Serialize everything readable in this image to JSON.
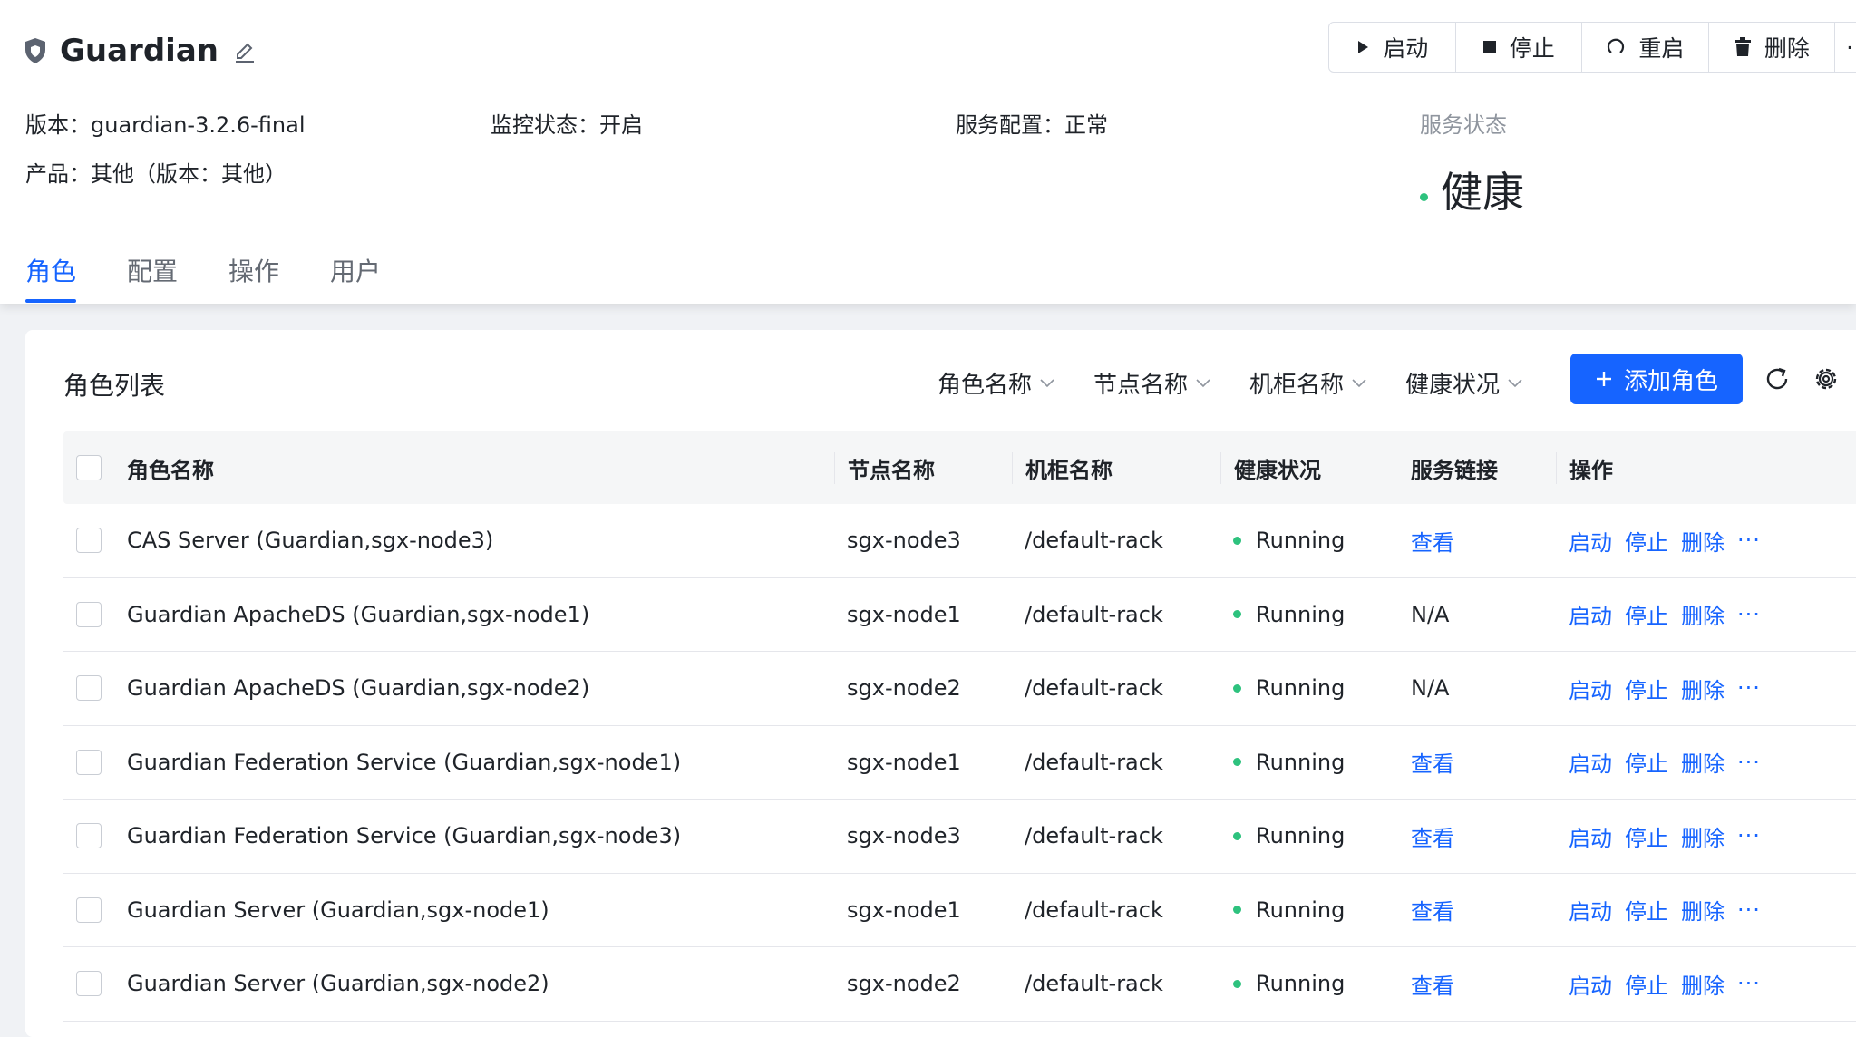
{
  "service": {
    "title": "Guardian",
    "version": "版本：guardian-3.2.6-final",
    "product": "产品：其他（版本：其他）",
    "monitor": "监控状态：开启",
    "config": "服务配置：正常",
    "status_label": "服务状态",
    "status_value": "健康"
  },
  "toolbar": {
    "start": "启动",
    "stop": "停止",
    "restart": "重启",
    "delete": "删除",
    "more": "·"
  },
  "tabs": [
    "角色",
    "配置",
    "操作",
    "用户"
  ],
  "card": {
    "title": "角色列表",
    "filters": [
      "角色名称",
      "节点名称",
      "机柜名称",
      "健康状况"
    ],
    "add_button": "添加角色"
  },
  "table": {
    "headers": {
      "name": "角色名称",
      "node": "节点名称",
      "rack": "机柜名称",
      "health": "健康状况",
      "link": "服务链接",
      "ops": "操作"
    },
    "ops_labels": {
      "start": "启动",
      "stop": "停止",
      "delete": "删除",
      "more": "···"
    },
    "rows": [
      {
        "name": "CAS Server (Guardian,sgx-node3)",
        "node": "sgx-node3",
        "rack": "/default-rack",
        "health": "Running",
        "link": "查看"
      },
      {
        "name": "Guardian ApacheDS (Guardian,sgx-node1)",
        "node": "sgx-node1",
        "rack": "/default-rack",
        "health": "Running",
        "link": "N/A"
      },
      {
        "name": "Guardian ApacheDS (Guardian,sgx-node2)",
        "node": "sgx-node2",
        "rack": "/default-rack",
        "health": "Running",
        "link": "N/A"
      },
      {
        "name": "Guardian Federation Service (Guardian,sgx-node1)",
        "node": "sgx-node1",
        "rack": "/default-rack",
        "health": "Running",
        "link": "查看"
      },
      {
        "name": "Guardian Federation Service (Guardian,sgx-node3)",
        "node": "sgx-node3",
        "rack": "/default-rack",
        "health": "Running",
        "link": "查看"
      },
      {
        "name": "Guardian Server (Guardian,sgx-node1)",
        "node": "sgx-node1",
        "rack": "/default-rack",
        "health": "Running",
        "link": "查看"
      },
      {
        "name": "Guardian Server (Guardian,sgx-node2)",
        "node": "sgx-node2",
        "rack": "/default-rack",
        "health": "Running",
        "link": "查看"
      }
    ]
  },
  "colors": {
    "primary": "#1664ff",
    "healthy": "#2ec27e"
  }
}
